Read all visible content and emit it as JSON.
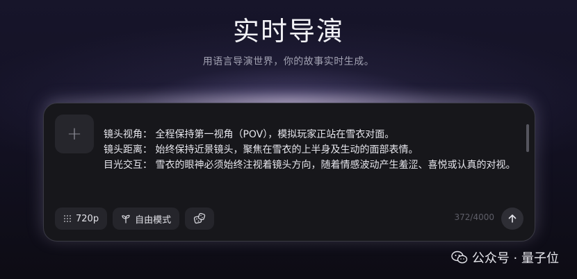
{
  "header": {
    "title": "实时导演",
    "subtitle": "用语言导演世界，你的故事实时生成。"
  },
  "prompt": {
    "lines": [
      "镜头视角： 全程保持第一视角（POV），模拟玩家正站在雪衣对面。",
      "镜头距离： 始终保持近景镜头，聚焦在雪衣的上半身及生动的面部表情。",
      "目光交互： 雪衣的眼神必须始终注视着镜头方向，随着情感波动产生羞涩、喜悦或认真的对视。"
    ]
  },
  "toolbar": {
    "resolution_label": "720p",
    "mode_label": "自由模式",
    "counter": "372/4000"
  },
  "icons": {
    "add": "plus-icon",
    "resolution": "grid-dots-icon",
    "mode": "sprout-icon",
    "random": "dice-icon",
    "send": "arrow-up-icon",
    "watermark": "wechat-icon"
  },
  "watermark": {
    "text": "公众号 · 量子位"
  }
}
